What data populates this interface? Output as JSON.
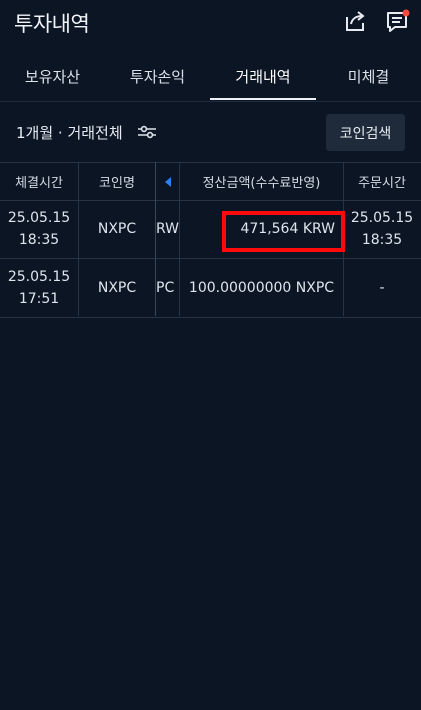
{
  "header": {
    "title": "투자내역",
    "share_icon": "share-icon",
    "message_icon": "message-icon",
    "notification_dot_color": "#ff4a3d"
  },
  "tabs": [
    {
      "label": "보유자산",
      "active": false
    },
    {
      "label": "투자손익",
      "active": false
    },
    {
      "label": "거래내역",
      "active": true
    },
    {
      "label": "미체결",
      "active": false
    }
  ],
  "filter": {
    "label": "1개월 · 거래전체",
    "filter_icon": "sliders-icon",
    "search_button": "코인검색"
  },
  "table": {
    "headers": [
      "체결시간",
      "코인명",
      "정산금액(수수료반영)",
      "주문시간"
    ],
    "scroll_icon": "arrow-left-icon",
    "rows": [
      {
        "exec_date": "25.05.15",
        "exec_time": "18:35",
        "coin": "NXPC",
        "partial": "RW",
        "settlement": "471,564 KRW",
        "order_date": "25.05.15",
        "order_time": "18:35"
      },
      {
        "exec_date": "25.05.15",
        "exec_time": "17:51",
        "coin": "NXPC",
        "partial": "PC",
        "settlement": "100.00000000 NXPC",
        "order_date": "-",
        "order_time": ""
      }
    ]
  },
  "colors": {
    "background": "#0b1524",
    "highlight_border": "#ff0a0a",
    "accent_arrow": "#2d7ff2"
  }
}
